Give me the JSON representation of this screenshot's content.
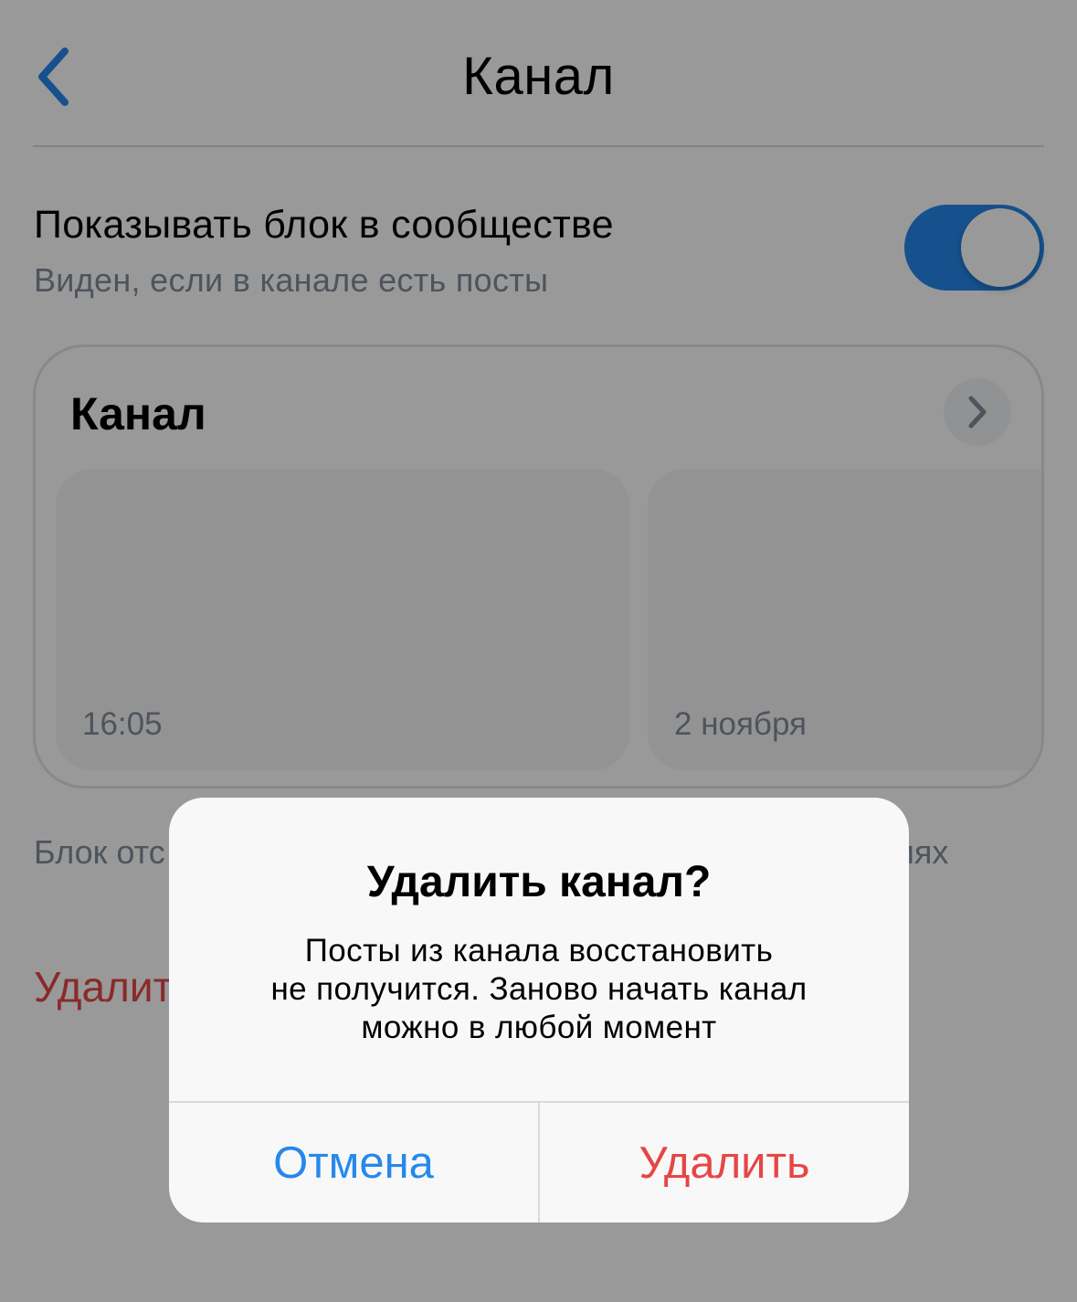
{
  "colors": {
    "accent": "#2688eb",
    "destructive": "#e64646",
    "secondary_text": "#818c99"
  },
  "nav": {
    "back_icon": "chevron-left-icon",
    "title": "Канал"
  },
  "setting": {
    "title": "Показывать блок в сообществе",
    "subtitle": "Виден, если в канале есть посты",
    "toggle_on": true
  },
  "card": {
    "title": "Канал",
    "arrow_icon": "chevron-right-icon",
    "posts": [
      {
        "time": "16:05"
      },
      {
        "time": "2 ноября"
      }
    ]
  },
  "footer": {
    "note_left": "Блок отс",
    "note_right": "иях",
    "delete_label": "Удалит"
  },
  "alert": {
    "title": "Удалить канал?",
    "message_lines": [
      "Посты из канала восстановить",
      "не получится. Заново начать канал",
      "можно в любой момент"
    ],
    "cancel_label": "Отмена",
    "confirm_label": "Удалить"
  }
}
